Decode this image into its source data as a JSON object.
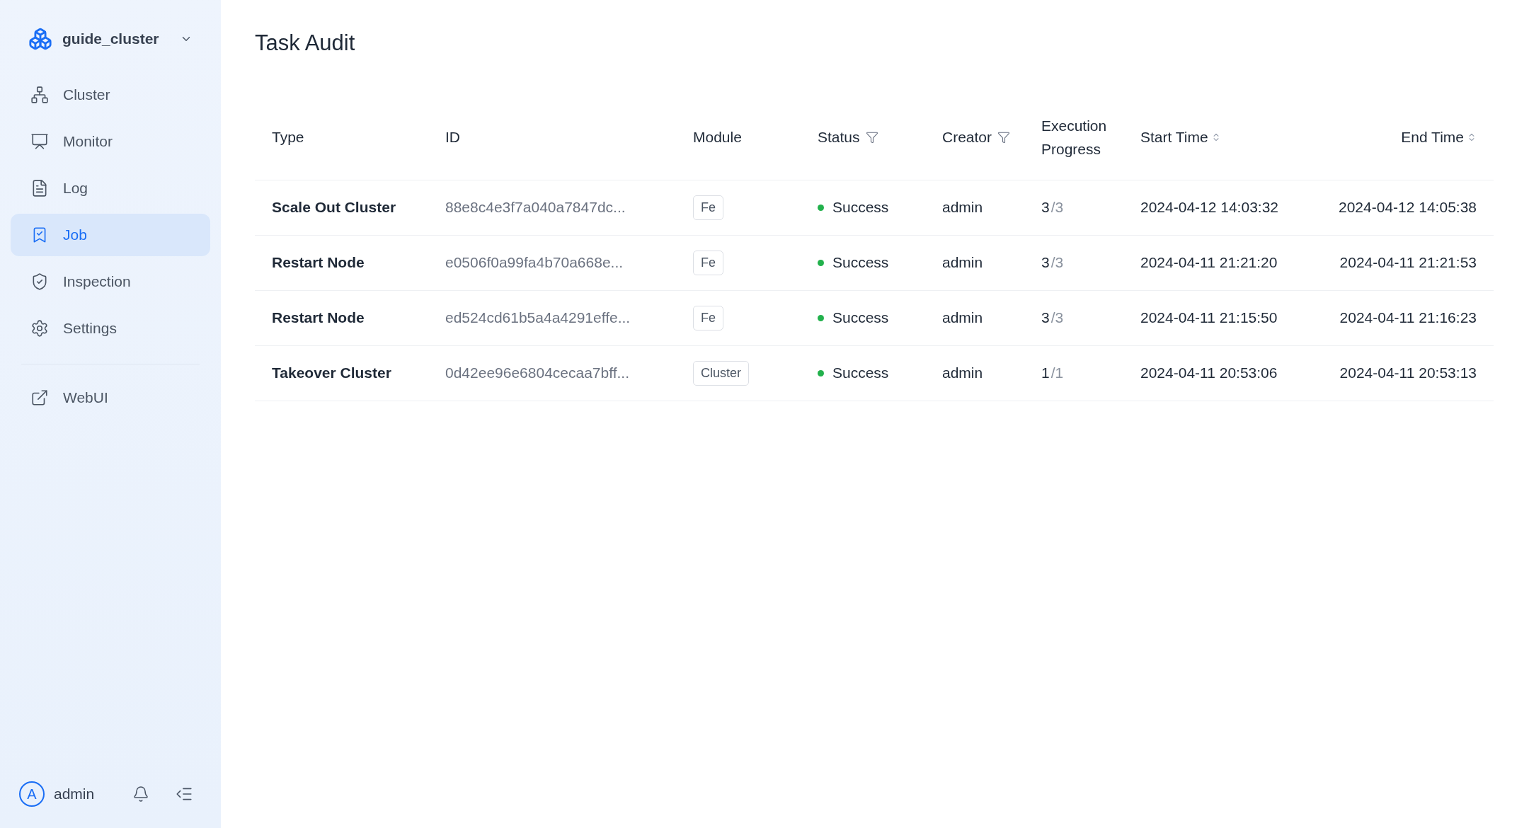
{
  "sidebar": {
    "cluster_name": "guide_cluster",
    "items": [
      {
        "label": "Cluster",
        "selected": false
      },
      {
        "label": "Monitor",
        "selected": false
      },
      {
        "label": "Log",
        "selected": false
      },
      {
        "label": "Job",
        "selected": true
      },
      {
        "label": "Inspection",
        "selected": false
      },
      {
        "label": "Settings",
        "selected": false
      }
    ],
    "links": [
      {
        "label": "WebUI"
      }
    ],
    "user": {
      "avatar": "A",
      "name": "admin"
    }
  },
  "page": {
    "title": "Task Audit"
  },
  "table": {
    "columns": [
      {
        "label": "Type",
        "kind": "plain"
      },
      {
        "label": "ID",
        "kind": "plain"
      },
      {
        "label": "Module",
        "kind": "plain"
      },
      {
        "label": "Status",
        "kind": "filter"
      },
      {
        "label": "Creator",
        "kind": "filter"
      },
      {
        "label": "Execution Progress",
        "kind": "plain"
      },
      {
        "label": "Start Time",
        "kind": "sort"
      },
      {
        "label": "End Time",
        "kind": "sort"
      }
    ],
    "rows": [
      {
        "type": "Scale Out Cluster",
        "id": "88e8c4e3f7a040a7847dc...",
        "module": "Fe",
        "status": "Success",
        "color": "#22b14c",
        "creator": "admin",
        "done": "3",
        "total": "/3",
        "start": "2024-04-12 14:03:32",
        "end": "2024-04-12 14:05:38"
      },
      {
        "type": "Restart Node",
        "id": "e0506f0a99fa4b70a668e...",
        "module": "Fe",
        "status": "Success",
        "color": "#22b14c",
        "creator": "admin",
        "done": "3",
        "total": "/3",
        "start": "2024-04-11 21:21:20",
        "end": "2024-04-11 21:21:53"
      },
      {
        "type": "Restart Node",
        "id": "ed524cd61b5a4a4291effe...",
        "module": "Fe",
        "status": "Success",
        "color": "#22b14c",
        "creator": "admin",
        "done": "3",
        "total": "/3",
        "start": "2024-04-11 21:15:50",
        "end": "2024-04-11 21:16:23"
      },
      {
        "type": "Takeover Cluster",
        "id": "0d42ee96e6804cecaa7bff...",
        "module": "Cluster",
        "status": "Success",
        "color": "#22b14c",
        "creator": "admin",
        "done": "1",
        "total": "/1",
        "start": "2024-04-11 20:53:06",
        "end": "2024-04-11 20:53:13"
      }
    ]
  }
}
